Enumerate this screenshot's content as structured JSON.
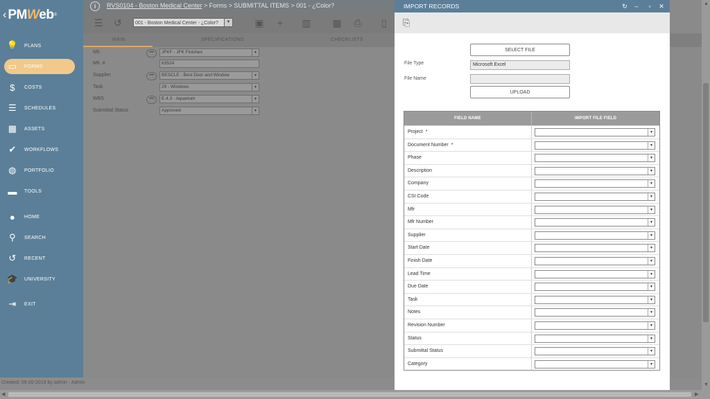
{
  "app": {
    "brand_prefix": "PM",
    "brand_suffix": "eb",
    "brand_w": "W",
    "back_glyph": "‹",
    "registered": "®"
  },
  "sidebar": {
    "items": [
      {
        "label": "PLANS",
        "icon": "lightbulb-icon",
        "glyph": "💡"
      },
      {
        "label": "FORMS",
        "icon": "folder-icon",
        "glyph": "▭",
        "active": true
      },
      {
        "label": "COSTS",
        "icon": "dollar-icon",
        "glyph": "$"
      },
      {
        "label": "SCHEDULES",
        "icon": "schedule-icon",
        "glyph": "☰"
      },
      {
        "label": "ASSETS",
        "icon": "building-icon",
        "glyph": "▦"
      },
      {
        "label": "WORKFLOWS",
        "icon": "check-icon",
        "glyph": "✔"
      },
      {
        "label": "PORTFOLIO",
        "icon": "globe-icon",
        "glyph": "◍"
      },
      {
        "label": "TOOLS",
        "icon": "toolbox-icon",
        "glyph": "▬"
      },
      {
        "label": "HOME",
        "icon": "person-icon",
        "glyph": "●"
      },
      {
        "label": "SEARCH",
        "icon": "search-icon",
        "glyph": "⚲"
      },
      {
        "label": "RECENT",
        "icon": "history-icon",
        "glyph": "↺"
      },
      {
        "label": "UNIVERSITY",
        "icon": "graduation-cap-icon",
        "glyph": "🎓"
      },
      {
        "label": "EXIT",
        "icon": "exit-icon",
        "glyph": "⇥"
      }
    ]
  },
  "header": {
    "info_glyph": "i",
    "breadcrumb_link": "RVS0104 - Boston Medical Center",
    "breadcrumb_rest": " > Forms > SUBMITTAL ITEMS > 001 - ¿Color?"
  },
  "toolbar": {
    "record_select": "001 - Boston Medical Center - ¿Color?"
  },
  "tabs": [
    {
      "label": "MAIN"
    },
    {
      "label": "SPECIFICATIONS"
    },
    {
      "label": "CHECKLISTS"
    }
  ],
  "form": {
    "fields": [
      {
        "label": "Mfr.",
        "value": "JFKF - JFK Finishes"
      },
      {
        "label": "Mfr. #",
        "value": "63524"
      },
      {
        "label": "Supplier",
        "value": "BESCLE - Best Door and Window"
      },
      {
        "label": "Task",
        "value": "29 - Windows"
      },
      {
        "label": "WBS",
        "value": "E.4.3 - Aquarium"
      },
      {
        "label": "Submittal Status",
        "value": "Approved"
      }
    ]
  },
  "status_bar": {
    "text": "Created:  09-20-2019 by admin - Admin"
  },
  "modal": {
    "title": "IMPORT RECORDS",
    "select_file_label": "SELECT FILE",
    "file_type_label": "File Type",
    "file_type_value": "Microsoft Excel",
    "file_name_label": "File Name",
    "file_name_value": "",
    "upload_label": "UPLOAD",
    "table": {
      "col_field": "FIELD NAME",
      "col_import": "IMPORT FILE FIELD",
      "rows": [
        {
          "field": "Project",
          "required": "*"
        },
        {
          "field": "Document Number",
          "required": "*"
        },
        {
          "field": "Phase",
          "required": ""
        },
        {
          "field": "Description",
          "required": ""
        },
        {
          "field": "Company",
          "required": ""
        },
        {
          "field": "CSI Code",
          "required": ""
        },
        {
          "field": "Mfr",
          "required": ""
        },
        {
          "field": "Mfr Number",
          "required": ""
        },
        {
          "field": "Supplier",
          "required": ""
        },
        {
          "field": "Start Date",
          "required": ""
        },
        {
          "field": "Finish Date",
          "required": ""
        },
        {
          "field": "Lead Time",
          "required": ""
        },
        {
          "field": "Due Date",
          "required": ""
        },
        {
          "field": "Task",
          "required": ""
        },
        {
          "field": "Notes",
          "required": ""
        },
        {
          "field": "Revision Number",
          "required": ""
        },
        {
          "field": "Status",
          "required": ""
        },
        {
          "field": "Submittal Status",
          "required": ""
        },
        {
          "field": "Category",
          "required": ""
        }
      ]
    }
  },
  "colors": {
    "sidebar": "#5b7f98",
    "active_nav": "#f2c98b",
    "modal_header": "#5b7f98",
    "table_header": "#9b9b9b"
  }
}
